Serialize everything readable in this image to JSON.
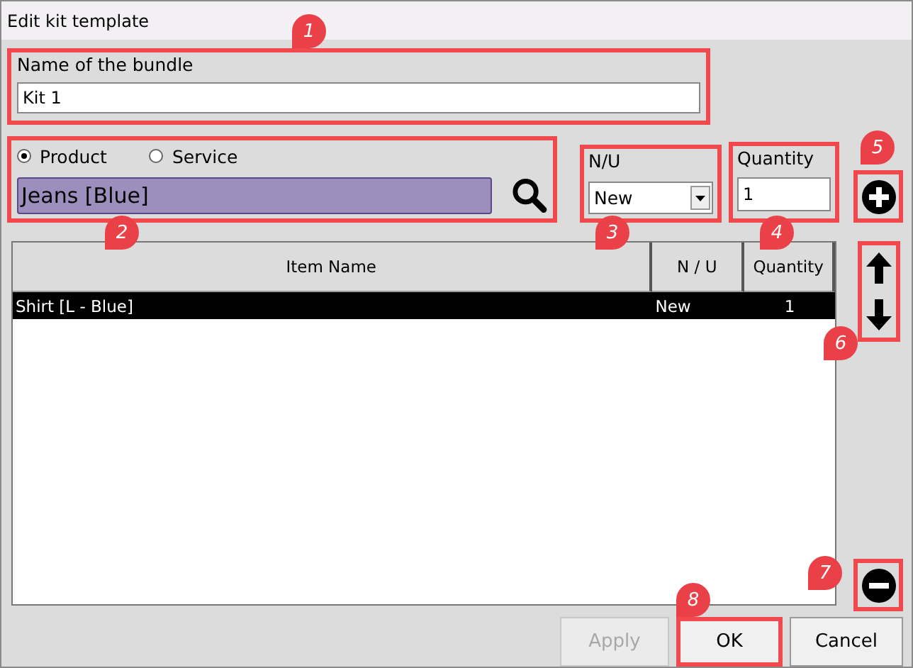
{
  "window": {
    "title": "Edit kit template"
  },
  "name_field": {
    "label": "Name of the bundle",
    "value": "Kit 1"
  },
  "type_options": [
    {
      "label": "Product",
      "selected": true
    },
    {
      "label": "Service",
      "selected": false
    }
  ],
  "item_field": {
    "value": "Jeans [Blue]"
  },
  "condition": {
    "label": "N/U",
    "value": "New"
  },
  "quantity": {
    "label": "Quantity",
    "value": "1"
  },
  "table": {
    "columns": [
      "Item Name",
      "N / U",
      "Quantity"
    ],
    "rows": [
      {
        "cells": [
          "Shirt [L - Blue]",
          "New",
          "1"
        ],
        "selected": true
      }
    ]
  },
  "buttons": [
    {
      "label": "Apply",
      "disabled": true
    },
    {
      "label": "OK",
      "disabled": false
    },
    {
      "label": "Cancel",
      "disabled": false
    }
  ],
  "callouts": [
    "1",
    "2",
    "3",
    "4",
    "5",
    "6",
    "7",
    "8"
  ]
}
